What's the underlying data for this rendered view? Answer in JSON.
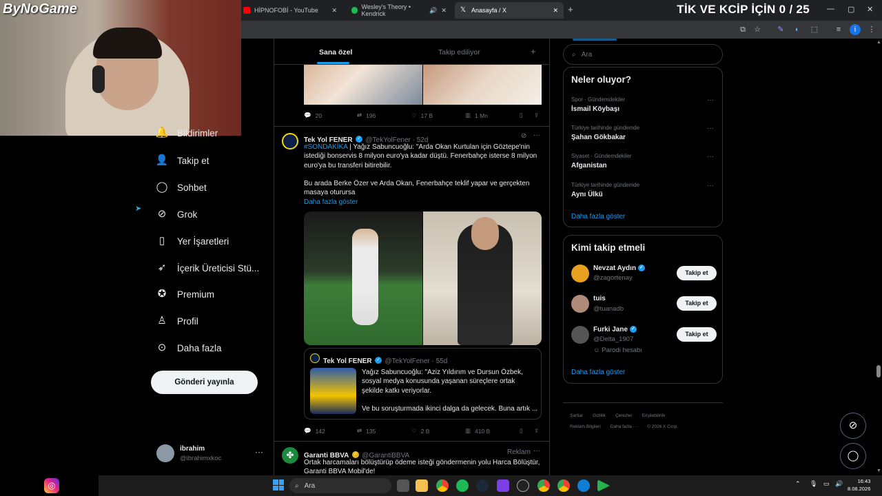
{
  "overlay": {
    "logo": "ByNoGame",
    "title": "TİK VE KCİP İÇİN 0 / 25"
  },
  "browser": {
    "tabs": [
      {
        "label": "HİPNOFOBİ - YouTube",
        "color": "#ff0000"
      },
      {
        "label": "Wesley's Theory • Kendrick",
        "color": "#1db954"
      },
      {
        "label": "Anasayfa / X",
        "color": "#ffffff"
      }
    ],
    "new_tab": "+",
    "window": {
      "min": "—",
      "max": "▢",
      "close": "✕"
    }
  },
  "nav": {
    "items": [
      {
        "label": "Bildirimler",
        "icon": "bell-icon"
      },
      {
        "label": "Takip et",
        "icon": "person-add-icon"
      },
      {
        "label": "Sohbet",
        "icon": "chat-icon"
      },
      {
        "label": "Grok",
        "icon": "grok-icon"
      },
      {
        "label": "Yer İşaretleri",
        "icon": "bookmark-icon"
      },
      {
        "label": "İçerik Üreticisi Stü...",
        "icon": "rocket-icon"
      },
      {
        "label": "Premium",
        "icon": "premium-icon"
      },
      {
        "label": "Profil",
        "icon": "profile-icon"
      },
      {
        "label": "Daha fazla",
        "icon": "more-circle-icon"
      }
    ],
    "post_button": "Gönderi yayınla",
    "account": {
      "name": "ibrahim",
      "handle": "@ibrahimxkoc",
      "more": "···"
    }
  },
  "timeline": {
    "tabs": {
      "for_you": "Sana özel",
      "following": "Takip ediliyor",
      "add": "+"
    },
    "tweet0_actions": {
      "replies": "20",
      "retweets": "196",
      "likes": "17 B",
      "views": "1 Mn"
    },
    "tweet1": {
      "name": "Tek Yol FENER",
      "handle": "@TekYolFener · 52d",
      "hashtag": "#SONDAKİKA",
      "text1": "| Yağız Sabuncuoğlu: \"Arda Okan Kurtulan için Göztepe'nin istediği bonservis 8 milyon euro'ya kadar düştü. Fenerbahçe isterse 8 milyon euro'ya bu transferi bitirebilir.",
      "text2": "Bu arada Berke Özer ve Arda Okan, Fenerbahçe teklif yapar ve gerçekten masaya oturursa",
      "show_more": "Daha fazla göster",
      "quote": {
        "name": "Tek Yol FENER",
        "handle": "@TekYolFener · 55d",
        "text1": "Yağız Sabuncuoğlu: \"Aziz Yıldırım ve Dursun Özbek, sosyal medya konusunda yaşanan süreçlere ortak şekilde katkı veriyorlar.",
        "text2": "Ve bu soruşturmada ikinci dalga da gelecek. Buna artık ..."
      },
      "actions": {
        "replies": "142",
        "retweets": "135",
        "likes": "2 B",
        "views": "410 B"
      }
    },
    "tweet2": {
      "name": "Garanti BBVA",
      "handle": "@GarantiBBVA",
      "ad": "Reklam",
      "text": "Ortak harcamaları bölüştürüp ödeme isteği göndermenin yolu Harca Bölüştür, Garanti BBVA Mobil'de!"
    }
  },
  "sidebar": {
    "search_placeholder": "Ara",
    "trends_title": "Neler oluyor?",
    "trends": [
      {
        "category": "Spor · Gündemdekiler",
        "name": "İsmail Köybaşı"
      },
      {
        "category": "Türkiye tarihinde gündemde",
        "name": "Şahan Gökbakar"
      },
      {
        "category": "Siyaset · Gündemdekiler",
        "name": "Afganistan"
      },
      {
        "category": "Türkiye tarihinde gündemde",
        "name": "Aynı Ülkü"
      }
    ],
    "trends_more": "Daha fazla göster",
    "who_title": "Kimi takip etmeli",
    "who": [
      {
        "name": "Nevzat Aydın",
        "handle": "@zagortenay",
        "extra": "",
        "button": "Takip et",
        "color": "#e8a020"
      },
      {
        "name": "tuis",
        "handle": "@tuanadb",
        "extra": "",
        "button": "Takip et",
        "color": "#b08a78"
      },
      {
        "name": "Furki Jane",
        "handle": "@Delta_1907",
        "extra": "Parodi hesabı",
        "button": "Takip et",
        "color": "#444"
      }
    ],
    "who_more": "Daha fazla göster",
    "footer": {
      "l1": [
        "Şartlar",
        "Gizlilik",
        "Çerezler",
        "Erişilebilirlik"
      ],
      "l2": [
        "Reklam Bilgileri",
        "Daha fazla ···",
        "© 2026 X Corp."
      ]
    }
  },
  "taskbar": {
    "search": "Ara",
    "time": "16:43",
    "date": "8.08.2026"
  }
}
